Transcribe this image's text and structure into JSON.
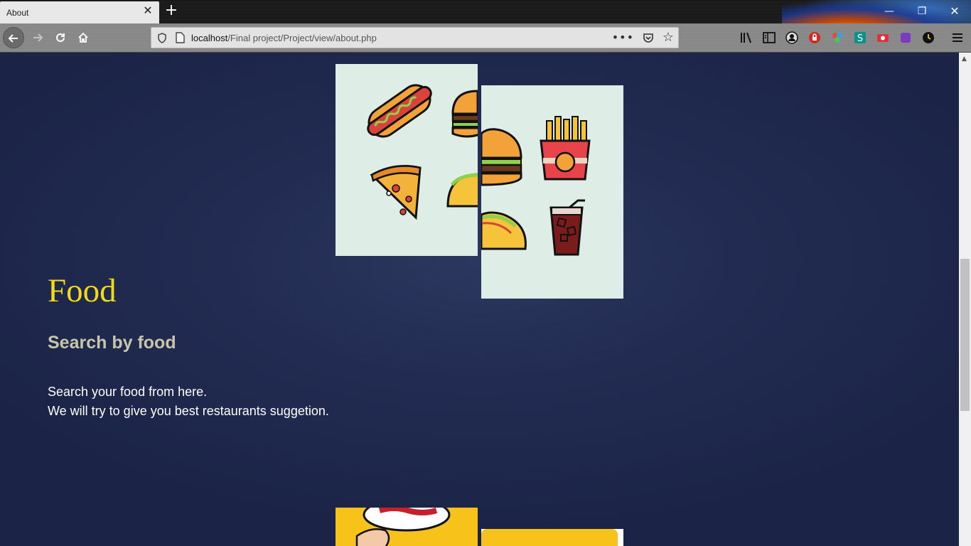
{
  "browser": {
    "tab_title": "About",
    "tab_close": "✕",
    "new_tab": "+",
    "url_host": "localhost",
    "url_path": "/Final project/Project/view/about.php",
    "url_more": "•••",
    "window_controls": {
      "minimize": "—",
      "maximize": "❐",
      "close": "✕"
    },
    "toolbar_icons": [
      "library-icon",
      "sidebar-icon",
      "account-icon",
      "extension-red-icon",
      "extension-color-icon",
      "extension-s-icon",
      "extension-camera-icon",
      "extension-purple-icon",
      "extension-clock-icon",
      "menu-icon"
    ]
  },
  "content": {
    "heading": "Food",
    "subheading": "Search by food",
    "description_line1": "Search your food from here.",
    "description_line2": "We will try to give you best restaurants suggetion."
  },
  "colors": {
    "page_background": "#1f2a4f",
    "heading": "#f4d81a",
    "subheading": "#c8c6a8",
    "card_background": "#deede6"
  }
}
